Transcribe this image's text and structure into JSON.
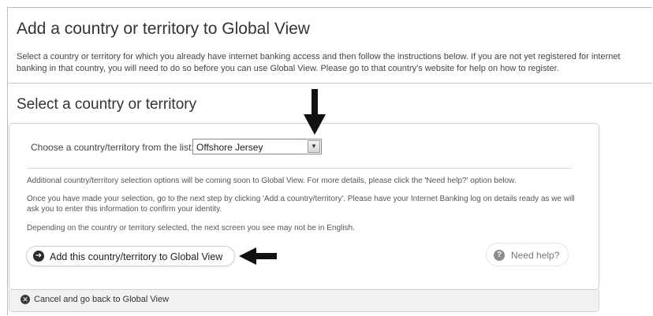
{
  "page": {
    "title": "Add a country or territory to Global View",
    "intro": "Select a country or territory for which you already have internet banking access and then follow the instructions below. If you are not yet registered for internet banking in that country, you will need to do so before you can use Global View. Please go to that country's website for help on how to register."
  },
  "section": {
    "title": "Select a country or territory",
    "choose_label": "Choose a country/territory from the list:",
    "select": {
      "value": "Offshore Jersey",
      "icon": "chevron-down-icon"
    },
    "notes": [
      "Additional country/territory selection options will be coming soon to Global View. For more details, please click the 'Need help?' option below.",
      "Once you have made your selection, go to the next step by clicking 'Add a country/territory'. Please have your Internet Banking log on details ready as we will ask you to enter this information to confirm your identity.",
      "Depending on the country or territory selected, the next screen you see may not be in English."
    ],
    "add_button": {
      "label": "Add this country/territory to Global View",
      "icon": "arrow-right-circle-icon"
    },
    "help_button": {
      "label": "Need help?",
      "icon": "question-circle-icon"
    }
  },
  "footer": {
    "cancel_label": "Cancel and go back to Global View",
    "cancel_icon": "close-circle-icon"
  },
  "colors": {
    "text": "#333333",
    "border": "#cfcfcf",
    "footer_bg": "#f1f1f1",
    "arrow": "#111111"
  }
}
